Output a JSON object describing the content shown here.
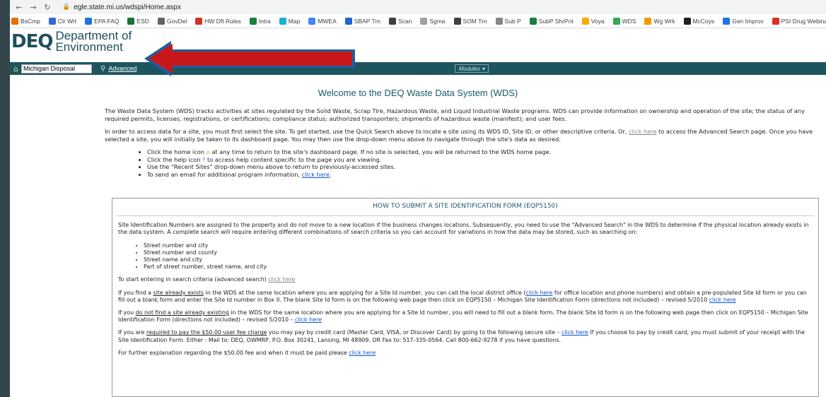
{
  "browser": {
    "url": "egle.state.mi.us/wdspi/Home.aspx",
    "bookmarks": [
      {
        "label": "BsCmp",
        "color": "#e8710a"
      },
      {
        "label": "Clr Wrt",
        "color": "#3367d6"
      },
      {
        "label": "EPA FAQ",
        "color": "#1a73e8"
      },
      {
        "label": "ESD",
        "color": "#137333"
      },
      {
        "label": "GovDel",
        "color": "#5f6368"
      },
      {
        "label": "HW Dft Rules",
        "color": "#d93025"
      },
      {
        "label": "Intra",
        "color": "#188038"
      },
      {
        "label": "Map",
        "color": "#12b5cb"
      },
      {
        "label": "MWEA",
        "color": "#4285f4"
      },
      {
        "label": "SBAP Trn",
        "color": "#1967d2"
      },
      {
        "label": "Scan",
        "color": "#3c4043"
      },
      {
        "label": "Sgma",
        "color": "#9aa0a6"
      },
      {
        "label": "SOM Trn",
        "color": "#3c4043"
      },
      {
        "label": "Sub P",
        "color": "#80868b"
      },
      {
        "label": "SubP ShrPnt",
        "color": "#188038"
      },
      {
        "label": "Voya",
        "color": "#f9ab00"
      },
      {
        "label": "WDS",
        "color": "#34a853"
      },
      {
        "label": "Wg Wrk",
        "color": "#f29900"
      },
      {
        "label": "McCoys",
        "color": "#202124"
      },
      {
        "label": "Gen Improv",
        "color": "#1a73e8"
      },
      {
        "label": "PSI Drug Webinar",
        "color": "#d93025"
      }
    ]
  },
  "header": {
    "logo_mark": "DEQ",
    "logo_line1": "Department of",
    "logo_line2": "Environment"
  },
  "menubar": {
    "search_value": "Michigan Disposal",
    "advanced_label": "Advanced",
    "modules_label": "Modules ▾"
  },
  "welcome": "Welcome to the DEQ Waste Data System (WDS)",
  "intro": {
    "p1": "The Waste Data System (WDS) tracks activities at sites regulated by the Solid Waste, Scrap Tire, Hazardous Waste, and Liquid Industrial Waste programs. WDS can provide information on ownership and operation of the site; the status of any required permits, licenses, registrations, or certifications; compliance status; authorized transporters; shipments of hazardous waste (manifest); and user fees.",
    "p2a": "In order to access data for a site, you must first select the site. To get started, use the Quick Search above to locate a site using its WDS ID, Site ID, or other descriptive criteria. Or,",
    "p2_link": "click here",
    "p2b": "to access the Advanced Search page. Once you have selected a site, you will initially be taken to its dashboard page. You may then use the drop-down menu above to navigate through the site's data as desired.",
    "b1a": "Click the home icon",
    "b1b": "at any time to return to the site's dashboard page. If no site is selected, you will be returned to the WDS home page.",
    "b2a": "Click the help icon",
    "b2b": "to access help content specific to the page you are viewing.",
    "b3": "Use the \"Recent Sites\" drop-down menu above to return to previously-accessed sites.",
    "b4a": "To send an email for additional program information,",
    "b4_link": "click here",
    "b4b": "."
  },
  "box": {
    "title": "HOW TO SUBMIT A SITE IDENTIFICATION FORM (EQP5150)",
    "p1": "Site Identification Numbers are assigned to the property and do not move to a new location if the business changes locations. Subsequently, you need to use the \"Advanced Search\" in the WDS to determine if the physical location already exists in the data system. A complete search will require entering different combinations of search criteria so you can account for variations in how the data may be stored, such as searching on:",
    "list": [
      "Street number and city",
      "Street number and county",
      "Street name and city",
      "Part of street number, street name, and city"
    ],
    "p2a": "To start entering in search criteria (advanced search)",
    "p2_link": "click here",
    "p3a": "If you find a",
    "p3_u": "site already exists",
    "p3b": "in the WDS at the same location where you are applying for a Site Id number, you can call the local district office (",
    "p3_link1": "click here",
    "p3c": "for office location and phone numbers) and obtain a pre-populated Site Id form or you can fill out a blank form and enter the Site Id number in Box II. The blank Site Id form is on the following web page then click on EQP5150 – Michigan Site Identification Form (directions not included) – revised 5/2010",
    "p3_link2": "click here",
    "p4a": "If you",
    "p4_u": "do not find a site already existing",
    "p4b": "in the WDS for the same location where you are applying for a Site Id number, you will need to fill out a blank form. The blank Site Id form is on the following web page then click on EQP5150 – Michigan Site Identification Form (directions not included) – revised 5/2010 –",
    "p4_link": "click here",
    "p5a": "If you are",
    "p5_u": "required to pay the $50.00 user fee charge",
    "p5b": "you may pay by credit card (Master Card, VISA, or Discover Card) by going to the following secure site –",
    "p5_link": "click here",
    "p5c": "If you choose to pay by credit card, you must submit of your receipt with the Site Identification Form. Either : Mail to: DEQ, OWMRP, P.O. Box 30241, Lansing, MI 48909. OR Fax to: 517-335-0564. Call 800-662-9278 if you have questions.",
    "p6a": "For further explanation regarding the $50.00 fee and when it must be paid please",
    "p6_link": "click here"
  }
}
